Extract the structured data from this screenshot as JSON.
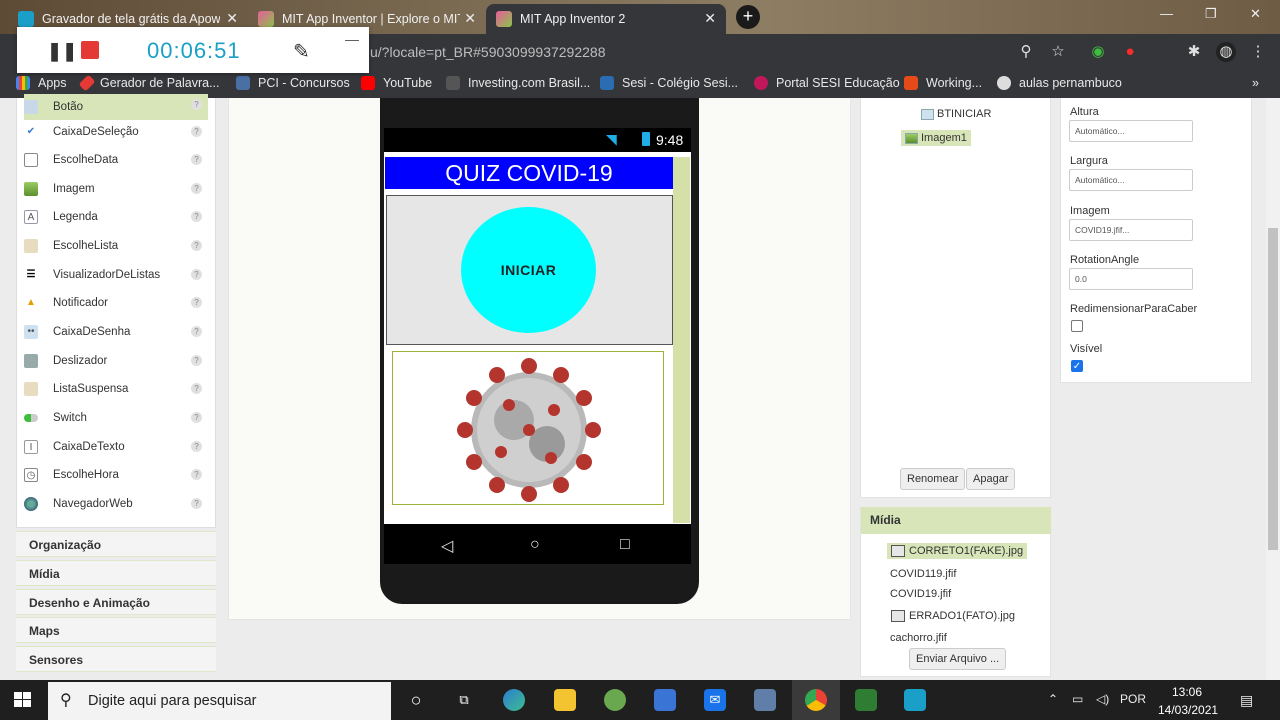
{
  "tabs": [
    {
      "title": "Gravador de tela grátis da Apowe",
      "active": false
    },
    {
      "title": "MIT App Inventor | Explore o MIT",
      "active": false
    },
    {
      "title": "MIT App Inventor 2",
      "active": true
    }
  ],
  "address_bar": {
    "url": "u/?locale=pt_BR#5903099937292288"
  },
  "bookmarks": [
    "Apps",
    "Gerador de Palavra...",
    "PCI - Concursos",
    "YouTube",
    "Investing.com Brasil...",
    "Sesi - Colégio Sesi...",
    "Portal SESI Educação",
    "Working...",
    "aulas pernambuco"
  ],
  "recorder": {
    "time": "00:06:51"
  },
  "palette": {
    "items": [
      "Botão",
      "CaixaDeSeleção",
      "EscolheData",
      "Imagem",
      "Legenda",
      "EscolheLista",
      "VisualizadorDeListas",
      "Notificador",
      "CaixaDeSenha",
      "Deslizador",
      "ListaSuspensa",
      "Switch",
      "CaixaDeTexto",
      "EscolheHora",
      "NavegadorWeb"
    ],
    "categories": [
      "Organização",
      "Mídia",
      "Desenho e Animação",
      "Maps",
      "Sensores"
    ]
  },
  "phone": {
    "time": "9:48",
    "title": "QUIZ COVID-19",
    "button": "INICIAR"
  },
  "components": {
    "items": [
      "BTINICIAR",
      "Imagem1"
    ],
    "rename": "Renomear",
    "delete": "Apagar"
  },
  "media": {
    "header": "Mídia",
    "files": [
      "CORRETO1(FAKE).jpg",
      "COVID119.jfif",
      "COVID19.jfif",
      "ERRADO1(FATO).jpg",
      "cachorro.jfif"
    ],
    "upload": "Enviar Arquivo ..."
  },
  "properties": {
    "height_label": "Altura",
    "height_value": "Automático...",
    "width_label": "Largura",
    "width_value": "Automático...",
    "image_label": "Imagem",
    "image_value": "COVID19.jfif...",
    "rotation_label": "RotationAngle",
    "rotation_value": "0.0",
    "scale_label": "RedimensionarParaCaber",
    "visible_label": "Visível"
  },
  "taskbar": {
    "search_placeholder": "Digite aqui para pesquisar",
    "lang": "POR",
    "time": "13:06",
    "date": "14/03/2021"
  },
  "colors": {
    "app_title_bg": "#0000ff",
    "button_bg": "#00ffff",
    "selected_green": "#d8e5b8"
  }
}
